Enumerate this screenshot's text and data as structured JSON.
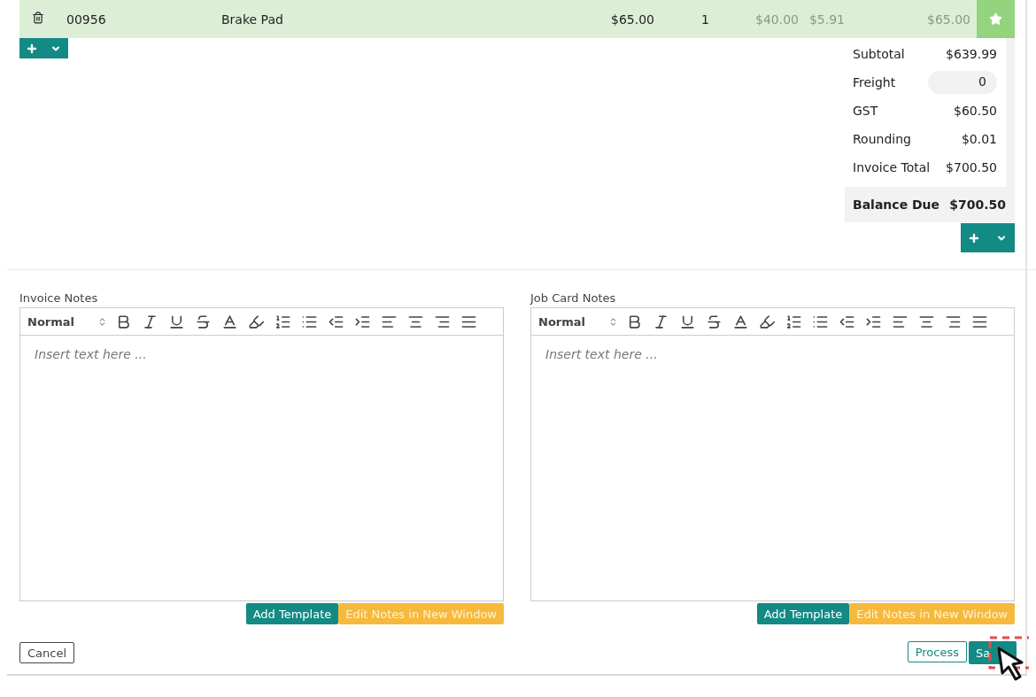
{
  "line_item": {
    "code": "00956",
    "description": "Brake Pad",
    "price": "$65.00",
    "quantity": "1",
    "cost": "$40.00",
    "tax": "$5.91",
    "total": "$65.00",
    "starred": true
  },
  "totals": [
    {
      "kind": "text",
      "label": "Subtotal",
      "value": "$639.99"
    },
    {
      "kind": "field",
      "label": "Freight",
      "value": "0"
    },
    {
      "kind": "text",
      "label": "GST",
      "value": "$60.50"
    },
    {
      "kind": "text",
      "label": "Rounding",
      "value": "$0.01"
    },
    {
      "kind": "text",
      "label": "Invoice Total",
      "value": "$700.50"
    }
  ],
  "balance_due": {
    "label": "Balance Due",
    "value": "$700.50"
  },
  "notes": [
    {
      "label": "Invoice Notes",
      "format": "Normal",
      "placeholder": "Insert text here ...",
      "add_template": "Add Template",
      "edit_window": "Edit Notes in New Window"
    },
    {
      "label": "Job Card Notes",
      "format": "Normal",
      "placeholder": "Insert text here ...",
      "add_template": "Add Template",
      "edit_window": "Edit Notes in New Window"
    }
  ],
  "footer": {
    "cancel": "Cancel",
    "process": "Process",
    "save": "Sa"
  }
}
